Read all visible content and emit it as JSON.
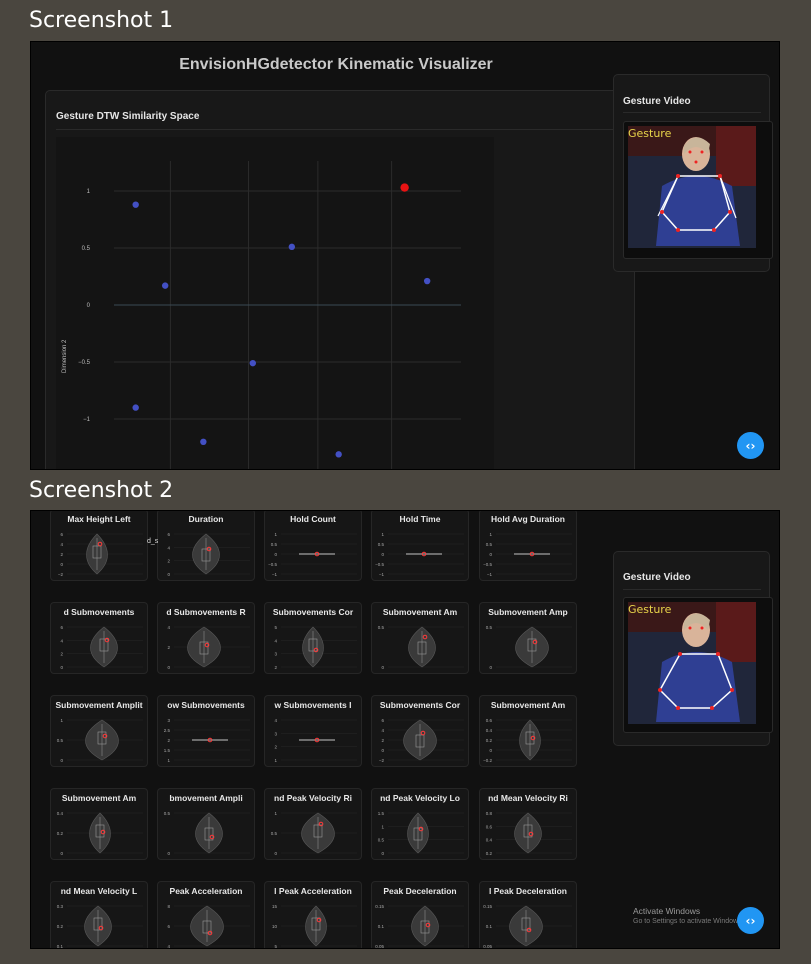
{
  "labels": {
    "shot1": "Screenshot 1",
    "shot2": "Screenshot 2"
  },
  "app": {
    "title": "EnvisionHGdetector Kinematic Visualizer"
  },
  "similarity": {
    "title": "Gesture DTW Similarity Space",
    "ylabel": "Dimension 2",
    "yticks": [
      "1",
      "0.5",
      "0",
      "−0.5",
      "−1"
    ]
  },
  "video": {
    "title": "Gesture Video",
    "overlay": "Gesture"
  },
  "chart_data": {
    "type": "scatter",
    "title": "Gesture DTW Similarity Space",
    "xlabel": "",
    "ylabel": "Dimension 2",
    "ylim": [
      -1.3,
      1.2
    ],
    "points": [
      {
        "x": -1.0,
        "y": 0.88,
        "selected": false
      },
      {
        "x": -0.66,
        "y": 0.17,
        "selected": false
      },
      {
        "x": -1.0,
        "y": -0.9,
        "selected": false
      },
      {
        "x": -0.22,
        "y": -1.2,
        "selected": false
      },
      {
        "x": 0.35,
        "y": -0.51,
        "selected": false
      },
      {
        "x": 0.8,
        "y": 0.51,
        "selected": false
      },
      {
        "x": 1.34,
        "y": -1.31,
        "selected": false
      },
      {
        "x": 2.1,
        "y": 1.03,
        "selected": true
      },
      {
        "x": 2.36,
        "y": 0.21,
        "selected": false
      }
    ],
    "colors": {
      "points": "#4350c4",
      "selected": "#e81313"
    }
  },
  "metrics": {
    "row1": [
      "Max Height Left",
      "Duration",
      "Hold Count",
      "Hold Time",
      "Hold Avg Duration"
    ],
    "row2": [
      "d Submovements",
      "d Submovements R",
      "Submovements Cor",
      "Submovement Am",
      "Submovement Amp"
    ],
    "row3": [
      "Submovement Amplit",
      "ow Submovements",
      "w Submovements I",
      "Submovements Cor",
      "Submovement Am"
    ],
    "row4": [
      "Submovement Am",
      "bmovement Ampli",
      "nd Peak Velocity Ri",
      "nd Peak Velocity Lo",
      "nd Mean Velocity Ri"
    ],
    "row5": [
      "nd Mean Velocity L",
      "Peak Acceleration",
      "l Peak Acceleration",
      "Peak Deceleration",
      "l Peak Deceleration"
    ]
  },
  "truncated_label": "d_s",
  "mini_ticks": {
    "r1": [
      [
        "6",
        "4",
        "2",
        "0",
        "−2"
      ],
      [
        "6",
        "4",
        "2",
        "0"
      ],
      [
        "1",
        "0.5",
        "0",
        "−0.5",
        "−1"
      ],
      [
        "1",
        "0.5",
        "0",
        "−0.5",
        "−1"
      ],
      [
        "1",
        "0.5",
        "0",
        "−0.5",
        "−1"
      ]
    ],
    "r2": [
      [
        "6",
        "4",
        "2",
        "0"
      ],
      [
        "4",
        "2",
        "0"
      ],
      [
        "5",
        "4",
        "3",
        "2"
      ],
      [
        "0.5",
        "0"
      ],
      [
        "0.5",
        "0"
      ]
    ],
    "r3": [
      [
        "1",
        "0.5",
        "0"
      ],
      [
        "3",
        "2.5",
        "2",
        "1.5",
        "1"
      ],
      [
        "4",
        "3",
        "2",
        "1"
      ],
      [
        "6",
        "4",
        "2",
        "0",
        "−2"
      ],
      [
        "0.6",
        "0.4",
        "0.2",
        "0",
        "−0.2"
      ]
    ],
    "r4": [
      [
        "0.4",
        "0.2",
        "0"
      ],
      [
        "0.5",
        "0"
      ],
      [
        "1",
        "0.5",
        "0"
      ],
      [
        "1.5",
        "1",
        "0.5",
        "0"
      ],
      [
        "0.8",
        "0.6",
        "0.4",
        "0.2"
      ]
    ],
    "r5": [
      [
        "0.3",
        "0.2",
        "0.1"
      ],
      [
        "8",
        "6",
        "4"
      ],
      [
        "15",
        "10",
        "5"
      ],
      [
        "0.15",
        "0.1",
        "0.05"
      ],
      [
        "0.15",
        "0.1",
        "0.05"
      ]
    ]
  },
  "watermark": {
    "line1": "Activate Windows",
    "line2": "Go to Settings to activate Windows."
  },
  "fab": {
    "icon": "code-toggle-icon",
    "label": "‹›"
  }
}
